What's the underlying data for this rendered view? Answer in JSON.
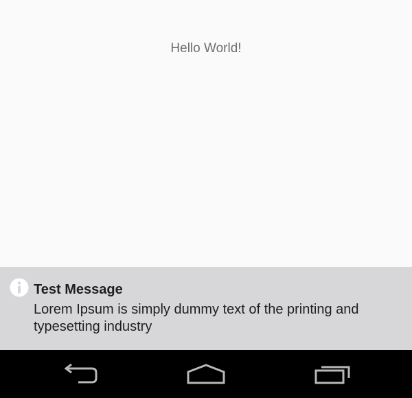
{
  "app": {
    "greeting": "Hello World!"
  },
  "notification": {
    "icon": "info-icon",
    "title": "Test Message",
    "body": "Lorem Ipsum is simply dummy text of the printing and typesetting industry"
  },
  "navigation_bar": {
    "buttons": [
      "back-icon",
      "home-icon",
      "recents-icon"
    ]
  },
  "colors": {
    "background": "#fafafa",
    "notification_background": "#d7d7d9",
    "navbar_background": "#000000",
    "icon_stroke": "#b8b8b8"
  }
}
